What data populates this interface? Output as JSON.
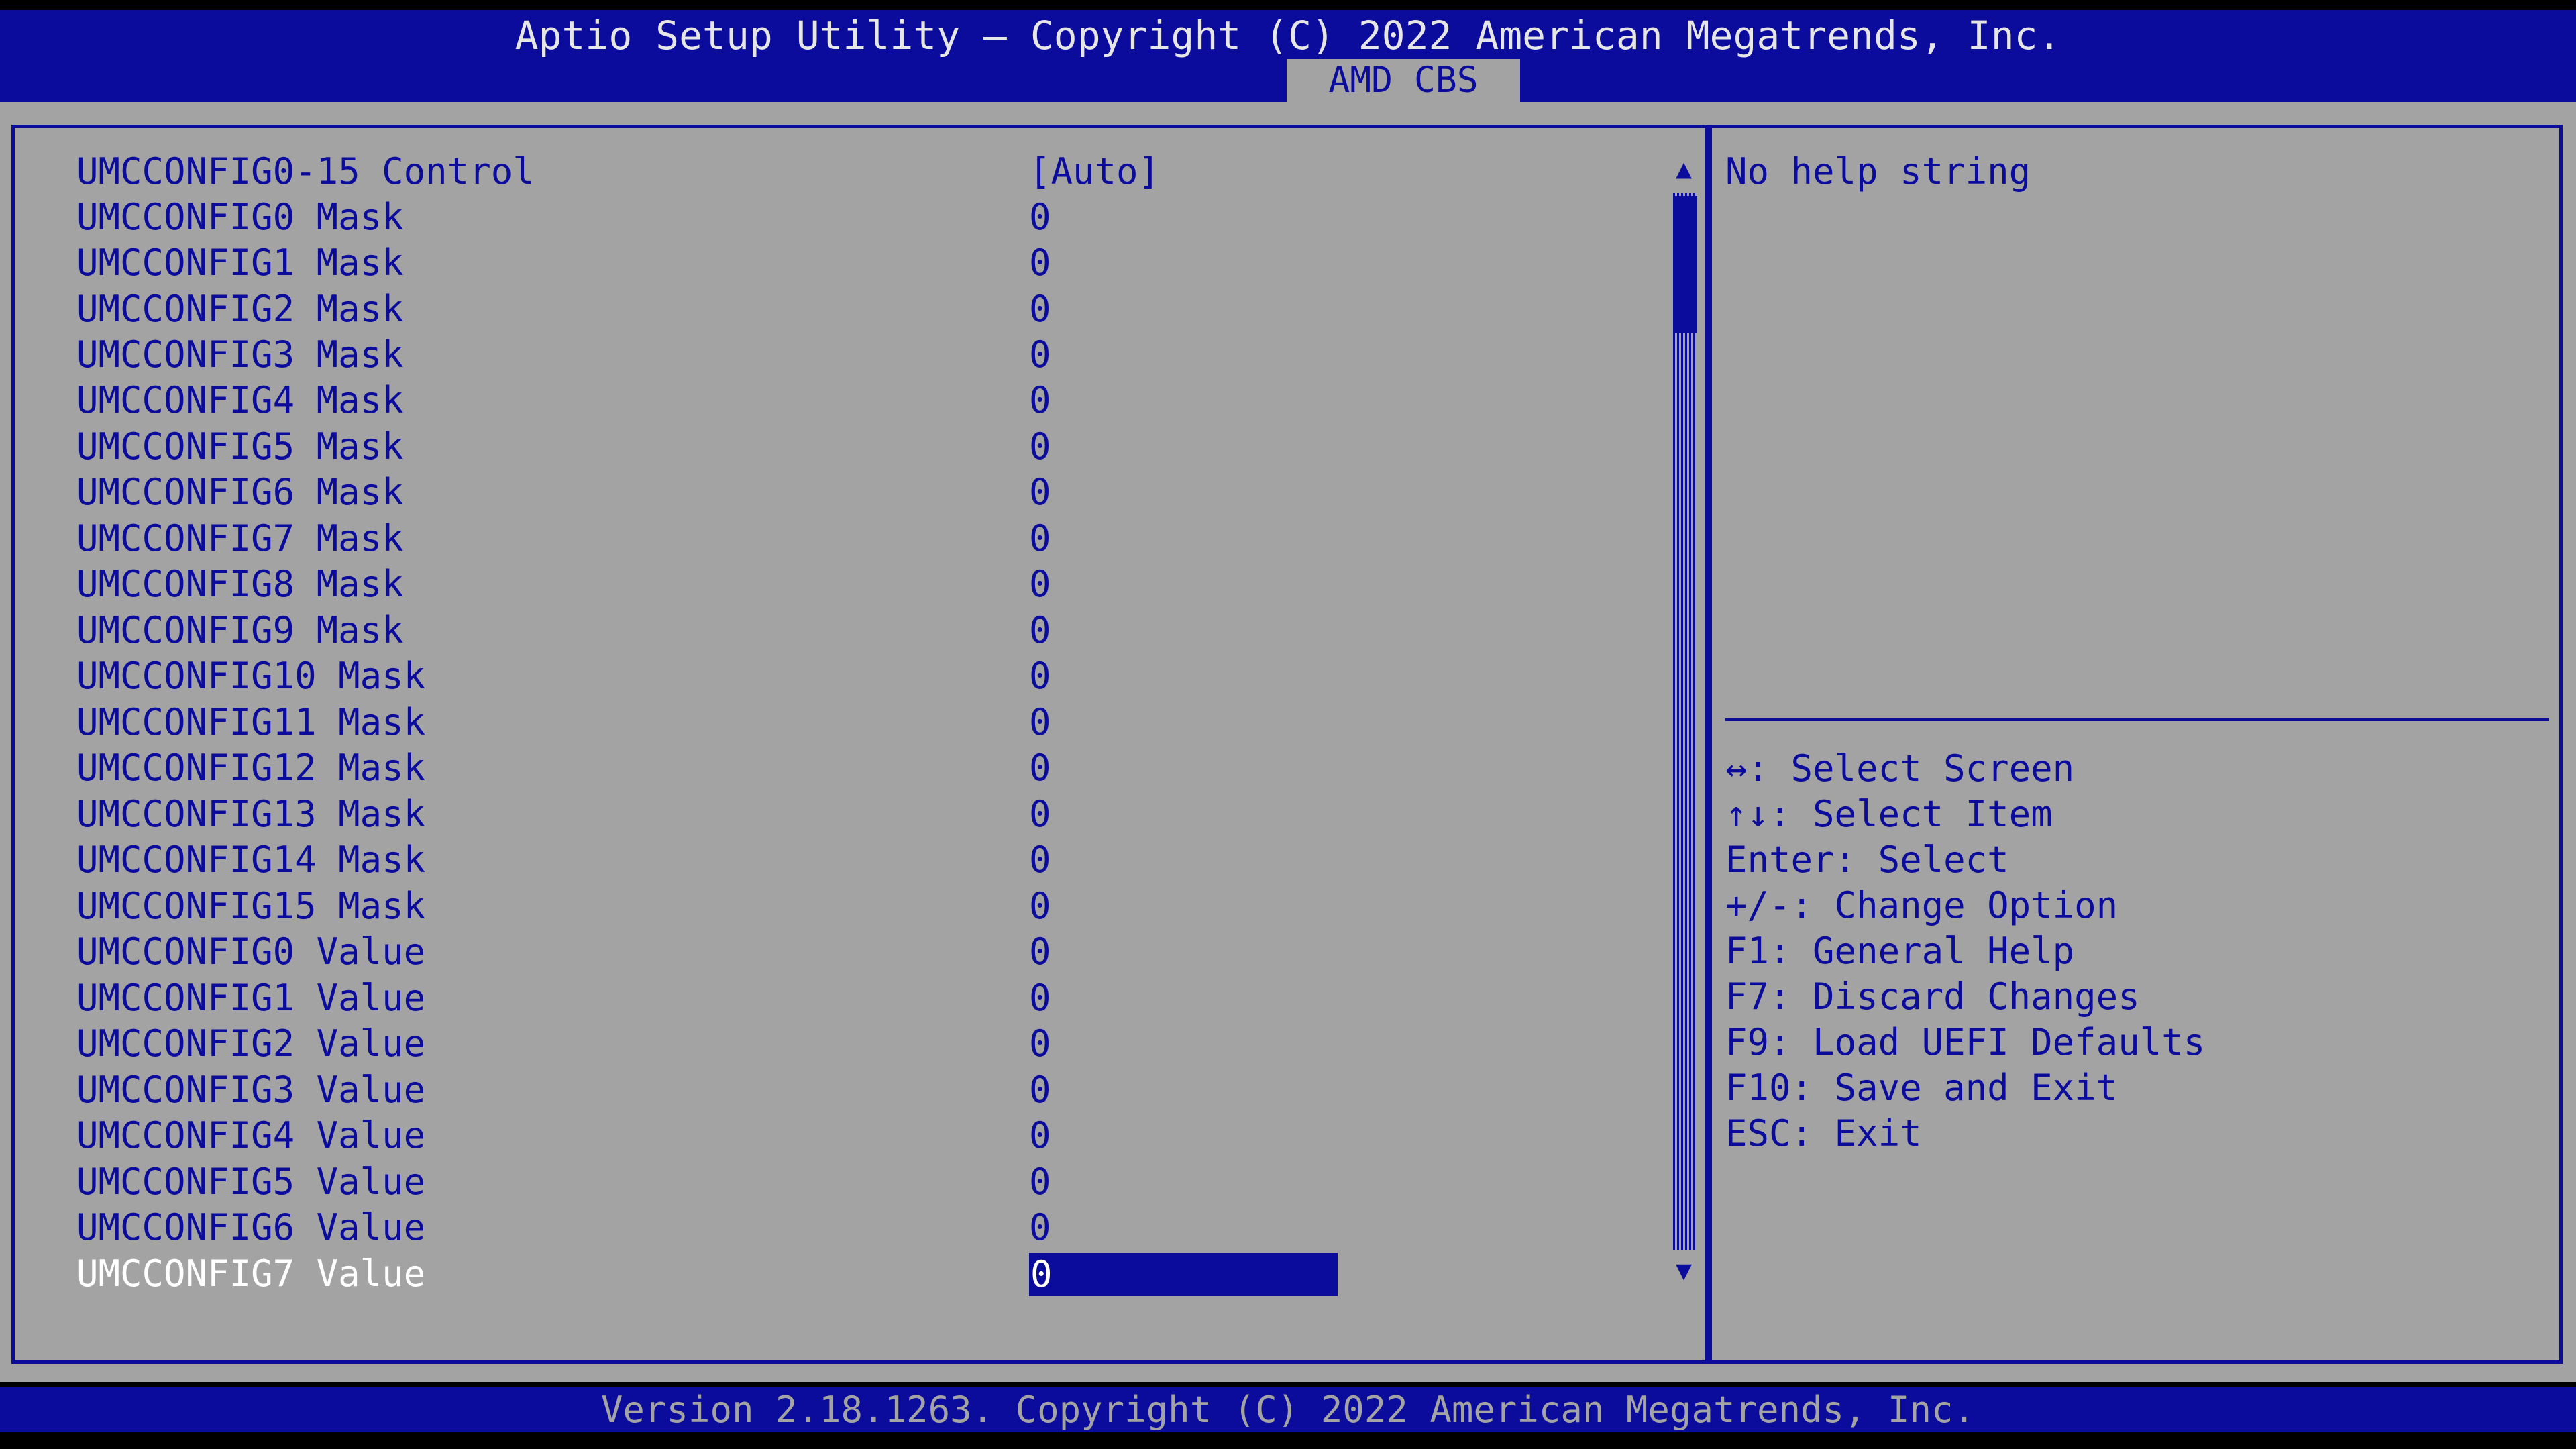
{
  "header": {
    "title": "Aptio Setup Utility – Copyright (C) 2022 American Megatrends, Inc.",
    "active_tab": "AMD CBS"
  },
  "settings": [
    {
      "label": "UMCCONFIG0-15 Control",
      "value": "[Auto]"
    },
    {
      "label": "UMCCONFIG0 Mask",
      "value": "0"
    },
    {
      "label": "UMCCONFIG1 Mask",
      "value": "0"
    },
    {
      "label": "UMCCONFIG2 Mask",
      "value": "0"
    },
    {
      "label": "UMCCONFIG3 Mask",
      "value": "0"
    },
    {
      "label": "UMCCONFIG4 Mask",
      "value": "0"
    },
    {
      "label": "UMCCONFIG5 Mask",
      "value": "0"
    },
    {
      "label": "UMCCONFIG6 Mask",
      "value": "0"
    },
    {
      "label": "UMCCONFIG7 Mask",
      "value": "0"
    },
    {
      "label": "UMCCONFIG8 Mask",
      "value": "0"
    },
    {
      "label": "UMCCONFIG9 Mask",
      "value": "0"
    },
    {
      "label": "UMCCONFIG10 Mask",
      "value": "0"
    },
    {
      "label": "UMCCONFIG11 Mask",
      "value": "0"
    },
    {
      "label": "UMCCONFIG12 Mask",
      "value": "0"
    },
    {
      "label": "UMCCONFIG13 Mask",
      "value": "0"
    },
    {
      "label": "UMCCONFIG14 Mask",
      "value": "0"
    },
    {
      "label": "UMCCONFIG15 Mask",
      "value": "0"
    },
    {
      "label": "UMCCONFIG0 Value",
      "value": "0"
    },
    {
      "label": "UMCCONFIG1 Value",
      "value": "0"
    },
    {
      "label": "UMCCONFIG2 Value",
      "value": "0"
    },
    {
      "label": "UMCCONFIG3 Value",
      "value": "0"
    },
    {
      "label": "UMCCONFIG4 Value",
      "value": "0"
    },
    {
      "label": "UMCCONFIG5 Value",
      "value": "0"
    },
    {
      "label": "UMCCONFIG6 Value",
      "value": "0"
    },
    {
      "label": "UMCCONFIG7 Value",
      "value": "0"
    }
  ],
  "scrollbar": {
    "up_icon": "▲",
    "down_icon": "▼"
  },
  "help": {
    "text": "No help string"
  },
  "keys": [
    "↔: Select Screen",
    "↑↓: Select Item",
    "Enter: Select",
    "+/-: Change Option",
    "F1: General Help",
    "F7: Discard Changes",
    "F9: Load UEFI Defaults",
    "F10: Save and Exit",
    "ESC: Exit"
  ],
  "footer": {
    "text": "Version 2.18.1263. Copyright (C) 2022 American Megatrends, Inc."
  },
  "colors": {
    "accent": "#0b0b9c",
    "background": "#a3a3a3",
    "selected_text": "#ffffff"
  }
}
